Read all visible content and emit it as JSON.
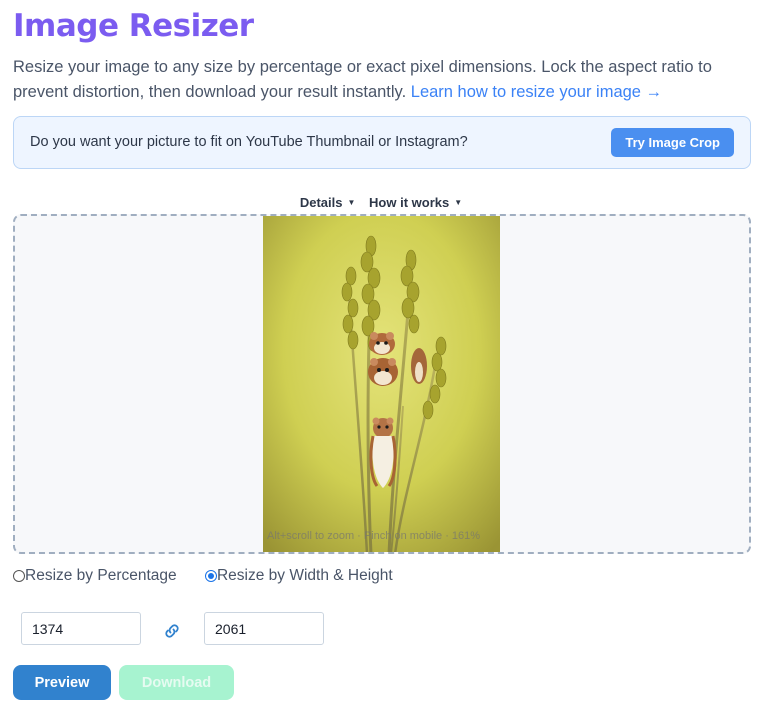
{
  "header": {
    "title": "Image Resizer",
    "description": "Resize your image to any size by percentage or exact pixel dimensions. Lock the aspect ratio to prevent distortion, then download your result instantly.",
    "learn_link": "Learn how to resize your image →"
  },
  "promo": {
    "text": "Do you want your picture to fit on YouTube Thumbnail or Instagram?",
    "button": "Try Image Crop"
  },
  "tabs": [
    {
      "label": "Details",
      "caret": "▼"
    },
    {
      "label": "How it works",
      "caret": "▼"
    }
  ],
  "preview": {
    "zoom_hint": "Alt+scroll to zoom · Pinch on mobile · 161%"
  },
  "resize_mode": {
    "options": [
      {
        "label": "Resize by Percentage",
        "selected": false
      },
      {
        "label": "Resize by Width & Height",
        "selected": true
      }
    ]
  },
  "dimensions": {
    "width": "1374",
    "height": "2061",
    "link_icon": "link-chain-icon"
  },
  "actions": {
    "preview": "Preview",
    "download": "Download"
  },
  "colors": {
    "title": "#7b5cf0",
    "link": "#3b82f6",
    "primary_button": "#3182ce",
    "disabled_download": "#a7f3d0"
  }
}
